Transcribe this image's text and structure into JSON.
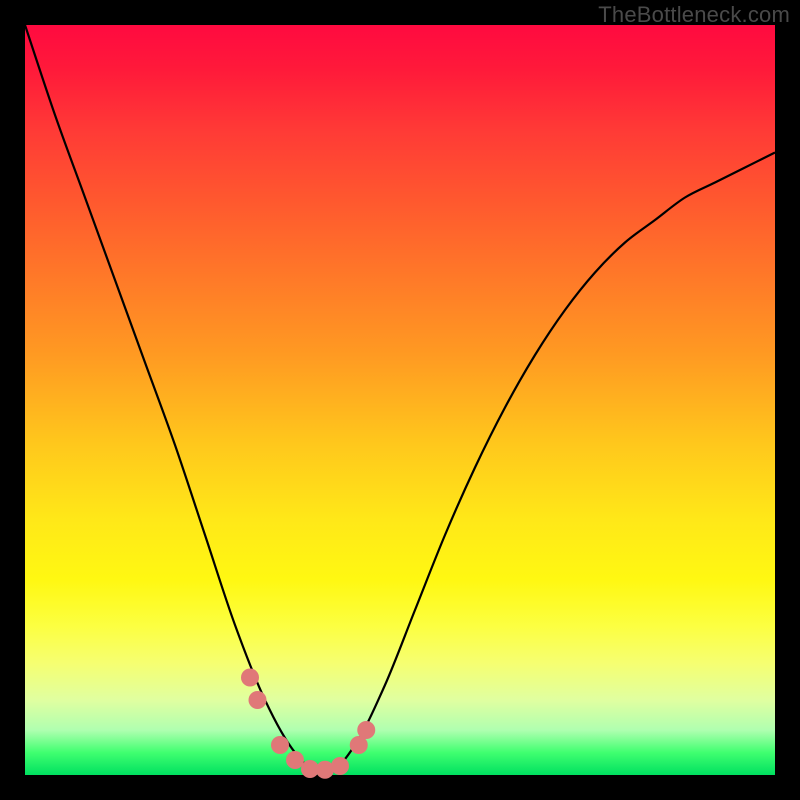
{
  "watermark": "TheBottleneck.com",
  "colors": {
    "frame": "#000000",
    "gradient_top": "#ff0a40",
    "gradient_bottom": "#00e060",
    "line": "#000000",
    "marker": "#e07878"
  },
  "chart_data": {
    "type": "line",
    "title": "",
    "xlabel": "",
    "ylabel": "",
    "xlim": [
      0,
      100
    ],
    "ylim": [
      0,
      100
    ],
    "x": [
      0,
      4,
      8,
      12,
      16,
      20,
      24,
      28,
      32,
      36,
      40,
      44,
      48,
      52,
      56,
      60,
      64,
      68,
      72,
      76,
      80,
      84,
      88,
      92,
      96,
      100
    ],
    "values": [
      100,
      88,
      77,
      66,
      55,
      44,
      32,
      20,
      10,
      3,
      0,
      4,
      12,
      22,
      32,
      41,
      49,
      56,
      62,
      67,
      71,
      74,
      77,
      79,
      81,
      83
    ],
    "annotations": [
      {
        "x": 30,
        "y": 13
      },
      {
        "x": 31,
        "y": 10
      },
      {
        "x": 34,
        "y": 4
      },
      {
        "x": 36,
        "y": 2
      },
      {
        "x": 38,
        "y": 0.8
      },
      {
        "x": 40,
        "y": 0.7
      },
      {
        "x": 42,
        "y": 1.2
      },
      {
        "x": 44.5,
        "y": 4
      },
      {
        "x": 45.5,
        "y": 6
      }
    ],
    "description": "V-shaped bottleneck curve descending from upper-left to a minimum near x≈40 then rising with decreasing slope toward the right; background is a vertical rainbow gradient (red top → green bottom); salmon dot markers cluster around the trough."
  }
}
